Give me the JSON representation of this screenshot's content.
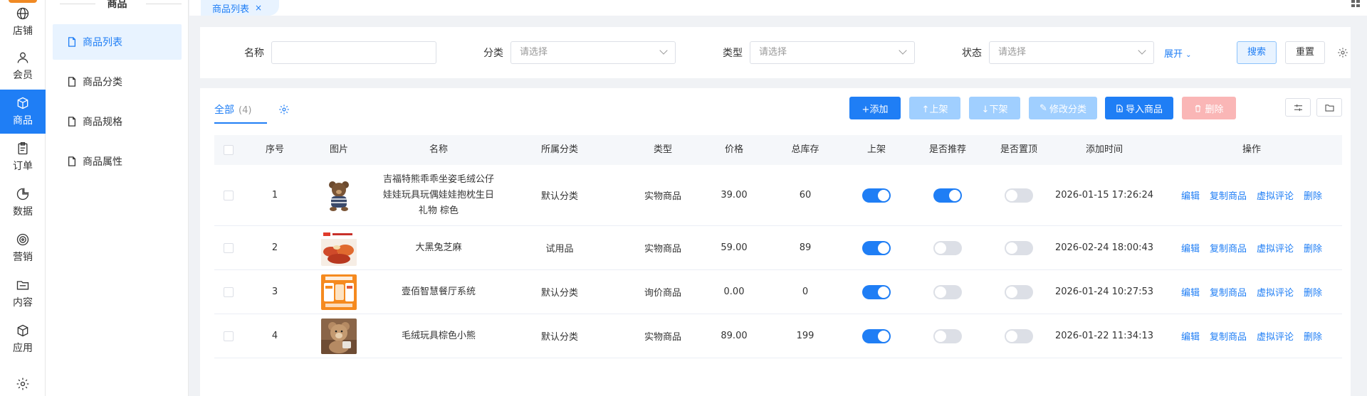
{
  "rail": {
    "items": [
      {
        "label": "店铺",
        "icon": "globe-icon"
      },
      {
        "label": "会员",
        "icon": "user-icon"
      },
      {
        "label": "商品",
        "icon": "box-icon"
      },
      {
        "label": "订单",
        "icon": "clipboard-icon"
      },
      {
        "label": "数据",
        "icon": "pie-chart-icon"
      },
      {
        "label": "营销",
        "icon": "target-icon"
      },
      {
        "label": "内容",
        "icon": "folder-icon"
      },
      {
        "label": "应用",
        "icon": "cube-icon"
      }
    ],
    "active": "商品"
  },
  "subnav": {
    "title": "商品",
    "items": [
      {
        "label": "商品列表"
      },
      {
        "label": "商品分类"
      },
      {
        "label": "商品规格"
      },
      {
        "label": "商品属性"
      }
    ]
  },
  "tabs": [
    {
      "label": "商品列表",
      "close": "×"
    }
  ],
  "filter": {
    "name_label": "名称",
    "category_label": "分类",
    "category_placeholder": "请选择",
    "type_label": "类型",
    "type_placeholder": "请选择",
    "status_label": "状态",
    "status_placeholder": "请选择",
    "expand_label": "展开",
    "search_label": "搜索",
    "reset_label": "重置"
  },
  "list": {
    "tab_label": "全部",
    "tab_count": "(4)",
    "toolbar": {
      "add": "+添加",
      "shelve": "↑上架",
      "unshelve": "↓下架",
      "edit_category": "修改分类",
      "import": "导入商品",
      "delete": "删除"
    },
    "columns": [
      "序号",
      "图片",
      "名称",
      "所属分类",
      "类型",
      "价格",
      "总库存",
      "上架",
      "是否推荐",
      "是否置顶",
      "添加时间",
      "操作"
    ],
    "actions": [
      "编辑",
      "复制商品",
      "虚拟评论",
      "删除"
    ],
    "rows": [
      {
        "index": "1",
        "thumb": "teddy-bear-striped",
        "name": "吉福特熊乖乖坐姿毛绒公仔娃娃玩具玩偶娃娃抱枕生日礼物 棕色",
        "category": "默认分类",
        "type": "实物商品",
        "price": "39.00",
        "stock": "60",
        "on_shelf": true,
        "recommended": true,
        "pinned": false,
        "added": "2026-01-15 17:26:24"
      },
      {
        "index": "2",
        "thumb": "food-promo",
        "name": "大黑兔芝麻",
        "category": "试用品",
        "type": "实物商品",
        "price": "59.00",
        "stock": "89",
        "on_shelf": true,
        "recommended": false,
        "pinned": false,
        "added": "2026-02-24 18:00:43"
      },
      {
        "index": "3",
        "thumb": "app-promo-orange",
        "name": "壹佰智慧餐厅系统",
        "category": "默认分类",
        "type": "询价商品",
        "price": "0.00",
        "stock": "0",
        "on_shelf": true,
        "recommended": false,
        "pinned": false,
        "added": "2026-01-24 10:27:53"
      },
      {
        "index": "4",
        "thumb": "brown-bear-plush",
        "name": "毛绒玩具棕色小熊",
        "category": "默认分类",
        "type": "实物商品",
        "price": "89.00",
        "stock": "199",
        "on_shelf": true,
        "recommended": false,
        "pinned": false,
        "added": "2026-01-22 11:34:13"
      }
    ]
  },
  "colors": {
    "primary": "#1f7ef5",
    "primary_light": "#e8f3ff",
    "disabled": "#a0cfff",
    "danger_light": "#fab6b6",
    "accent_orange": "#f08a24"
  }
}
